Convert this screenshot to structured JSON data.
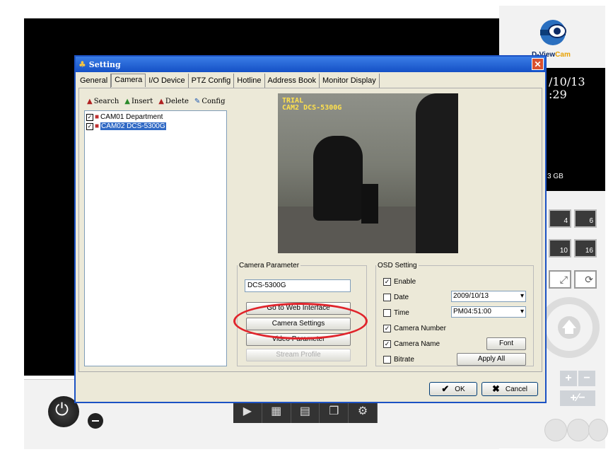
{
  "background": {
    "logo_text_main": "D-View",
    "logo_text_accent": "Cam",
    "date": "/10/13",
    "time": ":29",
    "storage": "3 GB",
    "grid_labels": [
      "4",
      "6",
      "10",
      "16"
    ],
    "zoom_in": "+",
    "zoom_out": "−",
    "zoom_fit": "+⁄−"
  },
  "dialog": {
    "title": "Setting",
    "close": "✕",
    "tabs": [
      "General",
      "Camera",
      "I/O Device",
      "PTZ Config",
      "Hotline",
      "Address Book",
      "Monitor Display"
    ],
    "toolbar": {
      "search": "Search",
      "insert": "Insert",
      "delete": "Delete",
      "config": "Config"
    },
    "tree": [
      {
        "label": "CAM01 Department"
      },
      {
        "label": "CAM02 DCS-5300G"
      }
    ],
    "preview": {
      "osd_line1": "TRIAL",
      "osd_line2": "CAM2 DCS-5300G"
    },
    "camera_parameter": {
      "legend": "Camera Parameter",
      "name_value": "DCS-5300G",
      "web_interface": "Go to Web Interface",
      "camera_settings": "Camera Settings",
      "video_parameter": "Video Parameter",
      "stream_profile": "Stream Profile"
    },
    "osd_setting": {
      "legend": "OSD Setting",
      "enable": "Enable",
      "date": "Date",
      "date_value": "2009/10/13",
      "time": "Time",
      "time_value": "PM04:51:00",
      "camera_number": "Camera Number",
      "camera_name": "Camera Name",
      "bitrate": "Bitrate",
      "font": "Font",
      "apply_all": "Apply All"
    },
    "ok": "OK",
    "cancel": "Cancel"
  },
  "colors": {
    "titlebar": "#1450c6",
    "highlight": "#e0242b",
    "selection": "#316ac5"
  }
}
